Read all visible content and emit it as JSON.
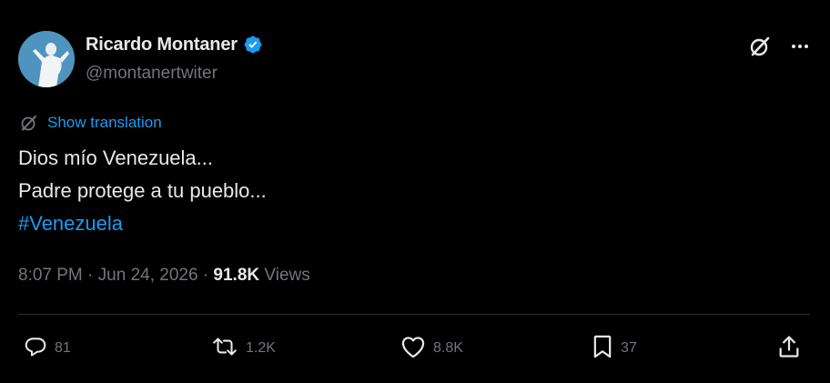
{
  "author": {
    "display_name": "Ricardo Montaner",
    "handle": "@montanertwiter",
    "verified": true
  },
  "translation": {
    "label": "Show translation"
  },
  "tweet": {
    "lines": [
      "Dios mío Venezuela...",
      "Padre protege a tu pueblo..."
    ],
    "hashtag": "#Venezuela"
  },
  "meta": {
    "time": "8:07 PM",
    "separator": "·",
    "date": "Jun 24, 2026",
    "views_count": "91.8K",
    "views_label": "Views"
  },
  "actions": {
    "replies": "81",
    "reposts": "1.2K",
    "likes": "8.8K",
    "bookmarks": "37"
  },
  "icons": {
    "verified": "verified-badge-icon",
    "grok": "grok-icon",
    "more": "more-icon",
    "translate": "translate-icon",
    "reply": "reply-icon",
    "repost": "repost-icon",
    "like": "heart-icon",
    "bookmark": "bookmark-icon",
    "share": "share-icon"
  },
  "colors": {
    "background": "#000000",
    "text_primary": "#e7e9ea",
    "text_secondary": "#71767b",
    "accent": "#1d9bf0",
    "divider": "#2f3336"
  }
}
